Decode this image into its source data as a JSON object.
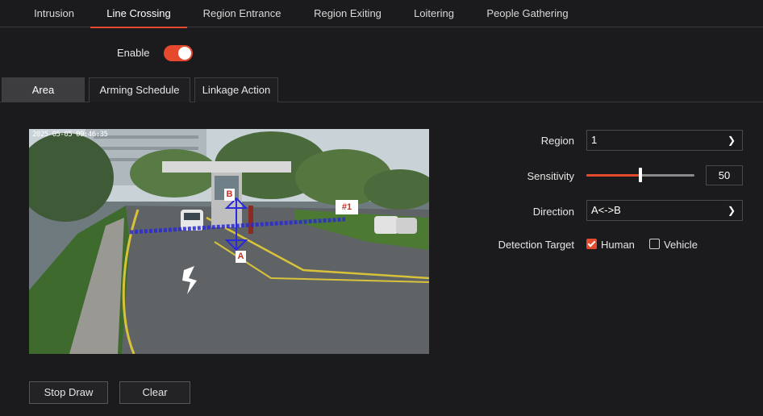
{
  "top_tabs": [
    {
      "label": "Intrusion"
    },
    {
      "label": "Line Crossing",
      "active": true
    },
    {
      "label": "Region Entrance"
    },
    {
      "label": "Region Exiting"
    },
    {
      "label": "Loitering"
    },
    {
      "label": "People Gathering"
    }
  ],
  "enable": {
    "label": "Enable",
    "on": true
  },
  "sub_tabs": [
    {
      "label": "Area",
      "active": true
    },
    {
      "label": "Arming Schedule"
    },
    {
      "label": "Linkage Action"
    }
  ],
  "video": {
    "timestamp": "2025-05-05 09:46:35",
    "line_id": "#1",
    "point_a": "A",
    "point_b": "B"
  },
  "settings": {
    "region_label": "Region",
    "region_value": "1",
    "sensitivity_label": "Sensitivity",
    "sensitivity_value": "50",
    "sensitivity_fraction": 0.5,
    "direction_label": "Direction",
    "direction_value": "A<->B",
    "detection_target_label": "Detection Target",
    "human_label": "Human",
    "human_checked": true,
    "vehicle_label": "Vehicle",
    "vehicle_checked": false
  },
  "buttons": {
    "stop_draw": "Stop Draw",
    "clear": "Clear"
  },
  "colors": {
    "accent": "#e64a2e",
    "background": "#1b1b1d",
    "line_overlay": "#2a2ad8"
  }
}
